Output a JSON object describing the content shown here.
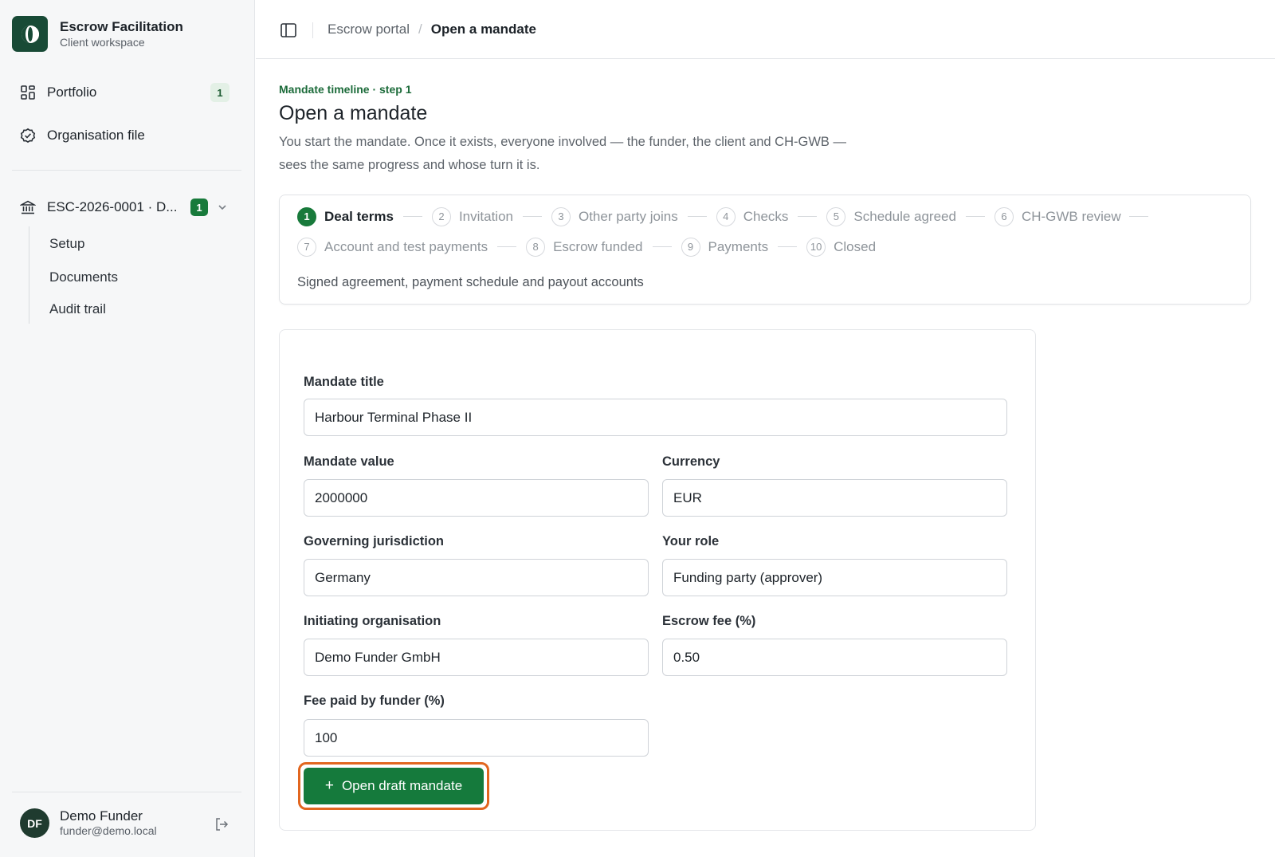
{
  "brand": {
    "name": "Escrow Facilitation",
    "subtitle": "Client workspace"
  },
  "sidebar": {
    "items": [
      {
        "label": "Portfolio",
        "badge": "1",
        "icon": "grid-icon"
      },
      {
        "label": "Organisation file",
        "icon": "check-circle-icon"
      }
    ],
    "mandate": {
      "label": "ESC-2026-0001 · D...",
      "badge": "1",
      "icon": "bank-icon"
    },
    "subitems": [
      {
        "label": "Setup"
      },
      {
        "label": "Documents"
      },
      {
        "label": "Audit trail"
      }
    ]
  },
  "user": {
    "initials": "DF",
    "name": "Demo Funder",
    "email": "funder@demo.local"
  },
  "header": {
    "breadcrumb": {
      "parent": "Escrow portal",
      "separator": "/",
      "current": "Open a mandate"
    }
  },
  "page": {
    "eyebrow": "Mandate timeline · step 1",
    "title": "Open a mandate",
    "description": "You start the mandate. Once it exists, everyone involved — the funder, the client and CH-GWB — sees the same progress and whose turn it is."
  },
  "timeline": {
    "steps": [
      {
        "num": "1",
        "label": "Deal terms",
        "active": true
      },
      {
        "num": "2",
        "label": "Invitation"
      },
      {
        "num": "3",
        "label": "Other party joins"
      },
      {
        "num": "4",
        "label": "Checks"
      },
      {
        "num": "5",
        "label": "Schedule agreed"
      },
      {
        "num": "6",
        "label": "CH-GWB review"
      },
      {
        "num": "7",
        "label": "Account and test payments"
      },
      {
        "num": "8",
        "label": "Escrow funded"
      },
      {
        "num": "9",
        "label": "Payments"
      },
      {
        "num": "10",
        "label": "Closed"
      }
    ],
    "caption": "Signed agreement, payment schedule and payout accounts"
  },
  "form": {
    "mandate_title": {
      "label": "Mandate title",
      "value": "Harbour Terminal Phase II"
    },
    "mandate_value": {
      "label": "Mandate value",
      "value": "2000000"
    },
    "currency": {
      "label": "Currency",
      "value": "EUR"
    },
    "jurisdiction": {
      "label": "Governing jurisdiction",
      "value": "Germany"
    },
    "role": {
      "label": "Your role",
      "value": "Funding party (approver)"
    },
    "organisation": {
      "label": "Initiating organisation",
      "value": "Demo Funder GmbH"
    },
    "escrow_fee": {
      "label": "Escrow fee (%)",
      "value": "0.50"
    },
    "fee_paid_by_funder": {
      "label": "Fee paid by funder (%)",
      "value": "100"
    },
    "submit": {
      "icon": "plus-icon",
      "label": "Open draft mandate"
    }
  },
  "colors": {
    "accent": "#157a3c",
    "brand_dark": "#184a36",
    "focus_ring": "#e2661f"
  }
}
